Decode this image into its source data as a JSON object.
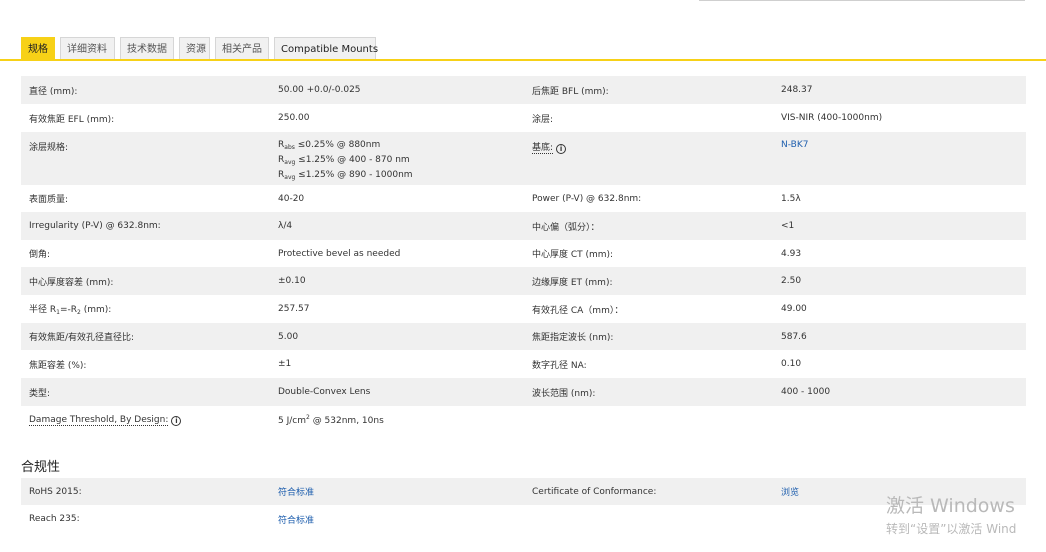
{
  "tabs": [
    "规格",
    "详细资料",
    "技术数据",
    "资源",
    "相关产品",
    "Compatible Mounts"
  ],
  "specs": {
    "r1": {
      "l1": "直径 (mm):",
      "v1": "50.00 +0.0/-0.025",
      "l2": "后焦距 BFL (mm):",
      "v2": "248.37"
    },
    "r2": {
      "l1": "有效焦距 EFL (mm):",
      "v1": "250.00",
      "l2": "涂层:",
      "v2": "VIS-NIR (400-1000nm)"
    },
    "r3": {
      "l1": "涂层规格:",
      "v1a_pre": "R",
      "v1a_sub": "abs",
      "v1a_post": " ≤0.25% @ 880nm",
      "v1b_pre": "R",
      "v1b_sub": "avg",
      "v1b_post": " ≤1.25% @ 400 - 870 nm",
      "v1c_pre": "R",
      "v1c_sub": "avg",
      "v1c_post": " ≤1.25% @ 890 - 1000nm",
      "l2": "基底:",
      "v2": "N-BK7"
    },
    "r4": {
      "l1": "表面质量:",
      "v1": "40-20",
      "l2": "Power (P-V) @ 632.8nm:",
      "v2": "1.5λ"
    },
    "r5": {
      "l1": "Irregularity (P-V) @ 632.8nm:",
      "v1": "λ/4",
      "l2": "中心偏（弧分）：",
      "v2": "<1"
    },
    "r6": {
      "l1": "倒角:",
      "v1": "Protective bevel as needed",
      "l2": "中心厚度 CT (mm):",
      "v2": "4.93"
    },
    "r7": {
      "l1": "中心厚度容差 (mm):",
      "v1": "±0.10",
      "l2": "边缘厚度 ET (mm):",
      "v2": "2.50"
    },
    "r8": {
      "l1_pre": "半径 R",
      "l1_sub1": "1",
      "l1_mid": "=-R",
      "l1_sub2": "2",
      "l1_post": " (mm):",
      "v1": "257.57",
      "l2": "有效孔径 CA（mm）：",
      "v2": "49.00"
    },
    "r9": {
      "l1": "有效焦距/有效孔径直径比:",
      "v1": "5.00",
      "l2": "焦距指定波长 (nm):",
      "v2": "587.6"
    },
    "r10": {
      "l1": "焦距容差 (%):",
      "v1": "±1",
      "l2": "数字孔径 NA:",
      "v2": "0.10"
    },
    "r11": {
      "l1": "类型:",
      "v1": "Double-Convex Lens",
      "l2": "波长范围 (nm):",
      "v2": "400 - 1000"
    },
    "r12": {
      "l1": "Damage Threshold, By Design:",
      "v1_pre": "5 J/cm",
      "v1_sup": "2",
      "v1_post": " @ 532nm, 10ns"
    }
  },
  "compliance": {
    "title": "合规性",
    "r1": {
      "l1": "RoHS 2015:",
      "v1": "符合标准",
      "l2": "Certificate of Conformance:",
      "v2": "浏览"
    },
    "r2": {
      "l1": "Reach 235:",
      "v1": "符合标准"
    }
  },
  "info_icon_glyph": "i",
  "watermark": {
    "line1": "激活 Windows",
    "line2": "转到“设置”以激活 Wind"
  },
  "colors": {
    "accent": "#f7d117",
    "link": "#1f5fae",
    "row_shade": "#f0f0f0"
  }
}
